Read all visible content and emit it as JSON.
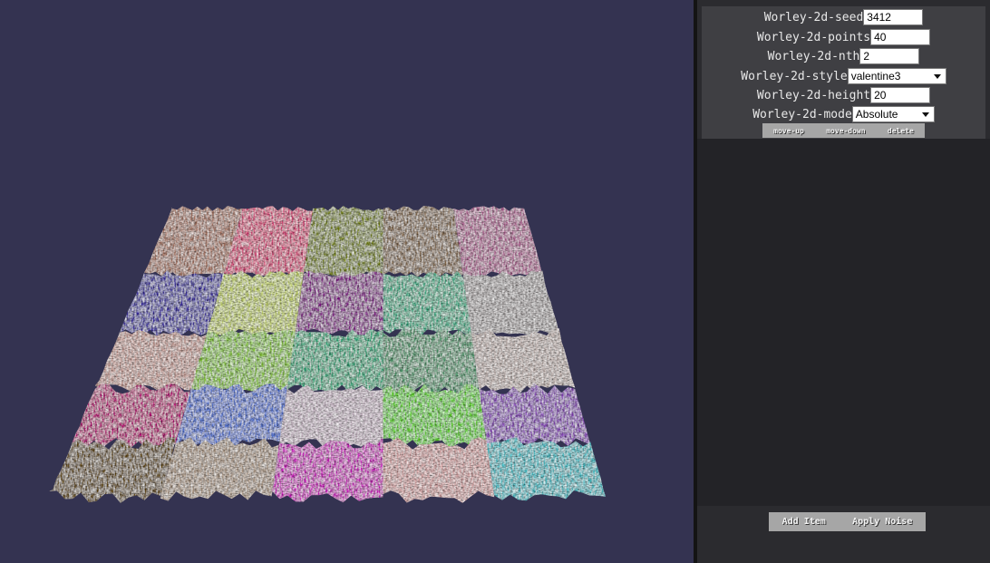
{
  "viewport": {
    "grid_colors": [
      [
        "#b07a66",
        "#e0457c",
        "#7f8d17",
        "#8a6e50",
        "#b8679a"
      ],
      [
        "#3d2fa8",
        "#c8d86a",
        "#8c1c92",
        "#3fb58c",
        "#b3aeae"
      ],
      [
        "#cfa49c",
        "#8ccd3a",
        "#35b383",
        "#4f9f70",
        "#cabcb8"
      ],
      [
        "#c0117c",
        "#5577d8",
        "#d3c2d0",
        "#63da26",
        "#8d46c0"
      ],
      [
        "#6b4f18",
        "#b39e8a",
        "#d41ec6",
        "#ddaaaa",
        "#46c4cc"
      ]
    ]
  },
  "noise_item": {
    "seed": {
      "label": "Worley-2d-seed",
      "value": "3412"
    },
    "points": {
      "label": "Worley-2d-points",
      "value": "40"
    },
    "nth": {
      "label": "Worley-2d-nth",
      "value": "2"
    },
    "style": {
      "label": "Worley-2d-style",
      "value": "valentine3"
    },
    "height": {
      "label": "Worley-2d-height",
      "value": "20"
    },
    "mode": {
      "label": "Worley-2d-mode",
      "value": "Absolute"
    },
    "buttons": {
      "move_up": "move-up",
      "move_down": "move-down",
      "delete": "delete"
    }
  },
  "bottom": {
    "add_item": "Add Item",
    "apply_noise": "Apply Noise"
  }
}
